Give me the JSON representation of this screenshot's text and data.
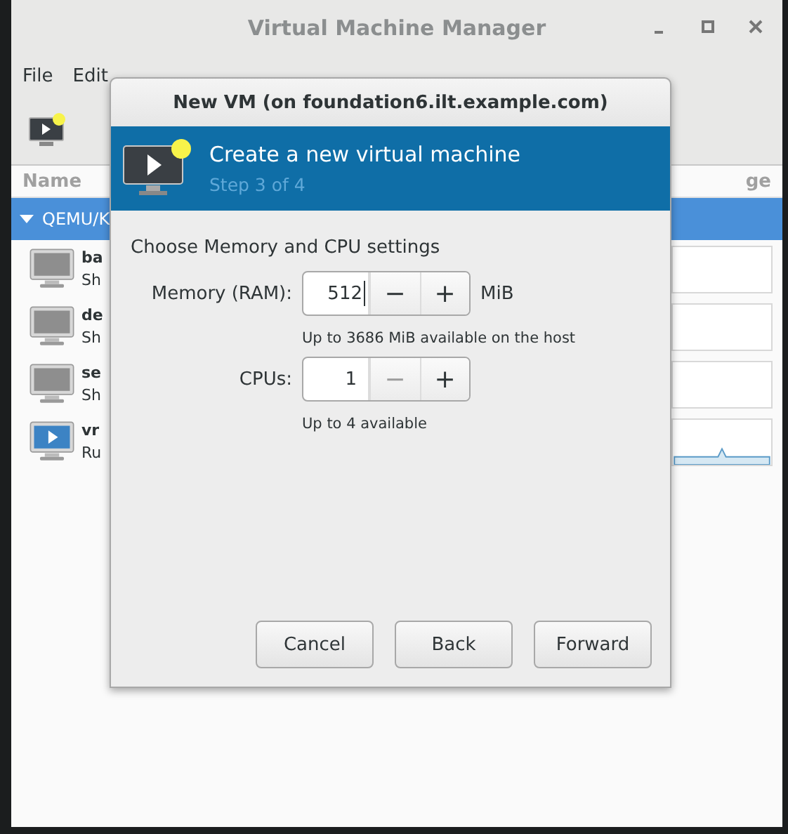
{
  "window": {
    "title": "Virtual Machine Manager"
  },
  "menu": [
    "File",
    "Edit"
  ],
  "columns": [
    "Name",
    "ge"
  ],
  "group": {
    "label": "QEMU/K",
    "expanded": true
  },
  "vms": [
    {
      "name": "ba",
      "status": "Sh",
      "running": false
    },
    {
      "name": "de",
      "status": "Sh",
      "running": false
    },
    {
      "name": "se",
      "status": "Sh",
      "running": false
    },
    {
      "name": "vr",
      "status": "Ru",
      "running": true
    }
  ],
  "dialog": {
    "title": "New VM (on foundation6.ilt.example.com)",
    "heading": "Create a new virtual machine",
    "step": "Step 3 of 4",
    "section": "Choose Memory and CPU settings",
    "fields": [
      {
        "label": "Memory (RAM):",
        "value": "512",
        "unit": "MiB",
        "hint": "Up to 3686 MiB available on the host",
        "decrement": "−",
        "increment": "+",
        "decrement_disabled": false,
        "focused": true
      },
      {
        "label": "CPUs:",
        "value": "1",
        "hint": "Up to 4 available",
        "decrement": "−",
        "increment": "+",
        "decrement_disabled": true,
        "focused": false
      }
    ],
    "buttons": [
      "Cancel",
      "Back",
      "Forward"
    ]
  }
}
